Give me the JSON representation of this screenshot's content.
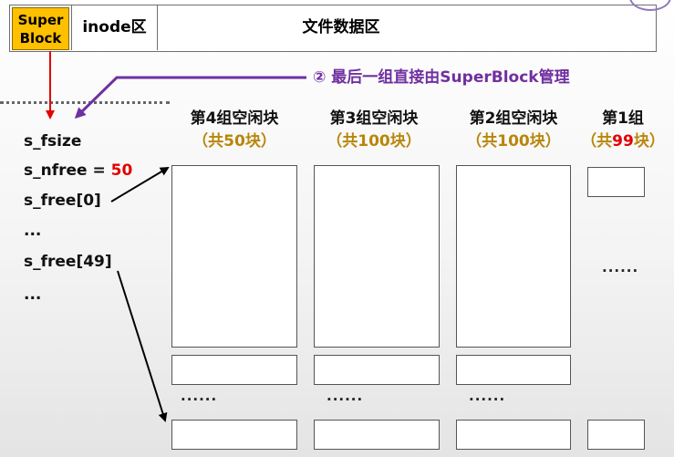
{
  "layout_bar": {
    "superblock_line1": "Super",
    "superblock_line2": "Block",
    "inode_label": "inode区",
    "data_label": "文件数据区"
  },
  "annotation": "② 最后一组直接由SuperBlock管理",
  "superblock_fields": {
    "s_fsize": "s_fsize",
    "s_nfree_label": "s_nfree =",
    "s_nfree_value": "50",
    "s_free0": "s_free[0]",
    "ellipsis1": "...",
    "s_free49": "s_free[49]",
    "ellipsis2": "..."
  },
  "groups": [
    {
      "title": "第4组空闲块",
      "count_open": "（共50块）"
    },
    {
      "title": "第3组空闲块",
      "count_open": "（共100块）"
    },
    {
      "title": "第2组空闲块",
      "count_open": "（共100块）"
    },
    {
      "title": "第1组",
      "count_pre": "（共",
      "count_value": "99",
      "count_post": "块）"
    }
  ],
  "dots": "......",
  "colors": {
    "superblock_fill": "#ffc000",
    "annotation": "#7030a0",
    "highlight_red": "#e30000",
    "count_gold": "#b8860b"
  }
}
